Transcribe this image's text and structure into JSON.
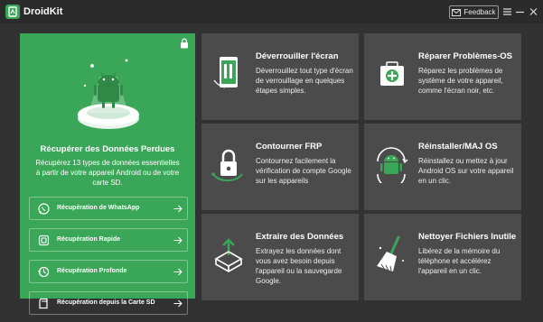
{
  "app": {
    "title": "DroidKit",
    "feedback_label": "Feedback"
  },
  "colors": {
    "accent": "#3aa657",
    "card_bg": "#4b4b4b",
    "window_bg": "#323232",
    "titlebar_bg": "#2b2b2b"
  },
  "hero": {
    "title": "Récupérer des Données Perdues",
    "description": "Récupérez 13 types de données essentielles à partir de votre appareil Android ou de votre carte SD.",
    "items": [
      {
        "label": "Récupération de WhatsApp",
        "icon": "whatsapp-icon"
      },
      {
        "label": "Récupération Rapide",
        "icon": "quick-recovery-icon"
      },
      {
        "label": "Récupération Profonde",
        "icon": "deep-recovery-icon"
      },
      {
        "label": "Récupération depuis la Carte SD",
        "icon": "sd-card-icon"
      }
    ]
  },
  "cards": [
    {
      "title": "Déverrouiller l'écran",
      "description": "Déverrouillez tout type d'écran de verrouillage en quelques étapes simples.",
      "icon": "unlock-screen-icon"
    },
    {
      "title": "Réparer Problèmes-OS",
      "description": "Réparez les problèmes de système de votre appareil, comme l'écran noir, etc.",
      "icon": "repair-os-icon"
    },
    {
      "title": "Contourner FRP",
      "description": "Contournez facilement la vérification de compte Google sur les appareils",
      "icon": "frp-lock-icon"
    },
    {
      "title": "Réinstaller/MAJ OS",
      "description": "Réinstallez ou mettez à jour Android OS sur votre appareil en un clic.",
      "icon": "android-reinstall-icon"
    },
    {
      "title": "Extraire des Données",
      "description": "Extrayez les données dont vous avez besoin depuis l'appareil ou la sauvegarde Google.",
      "icon": "extract-data-icon"
    },
    {
      "title": "Nettoyer Fichiers Inutile",
      "description": "Libérez de la mémoire du téléphone et accélérez l'appareil en un clic.",
      "icon": "broom-clean-icon"
    }
  ]
}
